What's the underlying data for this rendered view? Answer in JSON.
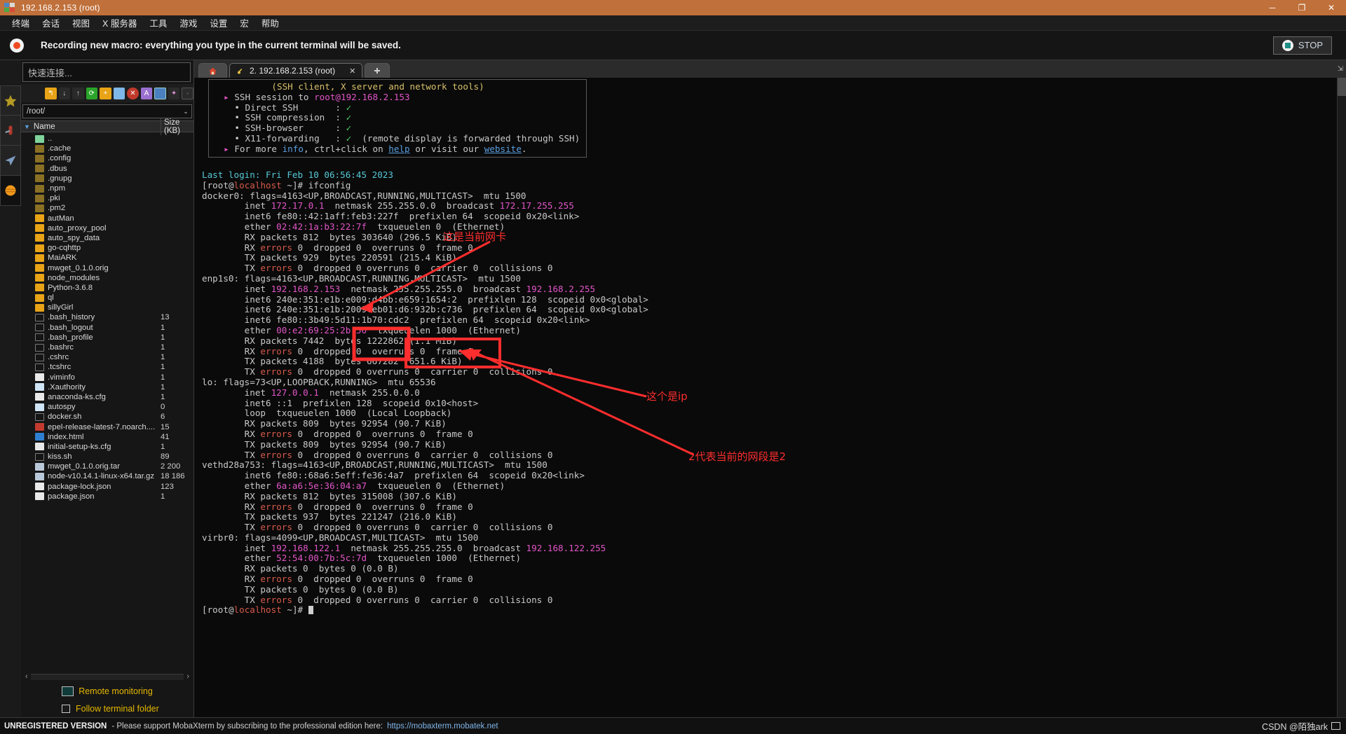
{
  "titlebar": {
    "title": "192.168.2.153 (root)",
    "minimize": "─",
    "maximize": "❐",
    "close": "✕"
  },
  "menubar": {
    "items": [
      "终端",
      "会话",
      "视图",
      "X 服务器",
      "工具",
      "游戏",
      "设置",
      "宏",
      "帮助"
    ]
  },
  "macrobar": {
    "message": "Recording new macro: everything you type in the current terminal will be saved.",
    "stop_label": "STOP"
  },
  "rail": {
    "items": [
      "star-icon",
      "tools-icon",
      "send-icon",
      "globe-icon"
    ]
  },
  "filebrowser": {
    "quick_connect_placeholder": "快速连接...",
    "path": "/root/",
    "columns": {
      "name": "Name",
      "size": "Size (KB)"
    },
    "sort_caret": "▼",
    "path_caret": "⌄",
    "toolbar_icons": [
      "up-dir-icon",
      "download-icon",
      "upload-icon",
      "refresh-icon",
      "new-folder-icon",
      "new-file-icon",
      "delete-icon",
      "text-view-icon",
      "split-view-icon",
      "magic-icon",
      "terminal-icon"
    ],
    "rows": [
      {
        "name": "..",
        "size": "",
        "icon": "up-folder-icon"
      },
      {
        "name": ".cache",
        "size": "",
        "icon": "folder-dim-icon"
      },
      {
        "name": ".config",
        "size": "",
        "icon": "folder-dim-icon"
      },
      {
        "name": ".dbus",
        "size": "",
        "icon": "folder-dim-icon"
      },
      {
        "name": ".gnupg",
        "size": "",
        "icon": "folder-dim-icon"
      },
      {
        "name": ".npm",
        "size": "",
        "icon": "folder-dim-icon"
      },
      {
        "name": ".pki",
        "size": "",
        "icon": "folder-dim-icon"
      },
      {
        "name": ".pm2",
        "size": "",
        "icon": "folder-dim-icon"
      },
      {
        "name": "autMan",
        "size": "",
        "icon": "folder-icon"
      },
      {
        "name": "auto_proxy_pool",
        "size": "",
        "icon": "folder-icon"
      },
      {
        "name": "auto_spy_data",
        "size": "",
        "icon": "folder-icon"
      },
      {
        "name": "go-cqhttp",
        "size": "",
        "icon": "folder-icon"
      },
      {
        "name": "MaiARK",
        "size": "",
        "icon": "folder-icon"
      },
      {
        "name": "mwget_0.1.0.orig",
        "size": "",
        "icon": "folder-icon"
      },
      {
        "name": "node_modules",
        "size": "",
        "icon": "folder-icon"
      },
      {
        "name": "Python-3.6.8",
        "size": "",
        "icon": "folder-icon"
      },
      {
        "name": "ql",
        "size": "",
        "icon": "folder-icon"
      },
      {
        "name": "sillyGirl",
        "size": "",
        "icon": "folder-icon"
      },
      {
        "name": ".bash_history",
        "size": "13",
        "icon": "shell-icon"
      },
      {
        "name": ".bash_logout",
        "size": "1",
        "icon": "shell-icon"
      },
      {
        "name": ".bash_profile",
        "size": "1",
        "icon": "shell-icon"
      },
      {
        "name": ".bashrc",
        "size": "1",
        "icon": "shell-icon"
      },
      {
        "name": ".cshrc",
        "size": "1",
        "icon": "shell-icon"
      },
      {
        "name": ".tcshrc",
        "size": "1",
        "icon": "shell-icon"
      },
      {
        "name": ".viminfo",
        "size": "1",
        "icon": "config-icon"
      },
      {
        "name": ".Xauthority",
        "size": "1",
        "icon": "file-icon"
      },
      {
        "name": "anaconda-ks.cfg",
        "size": "1",
        "icon": "config-icon"
      },
      {
        "name": "autospy",
        "size": "0",
        "icon": "file-icon"
      },
      {
        "name": "docker.sh",
        "size": "6",
        "icon": "shell-icon"
      },
      {
        "name": "epel-release-latest-7.noarch....",
        "size": "15",
        "icon": "rpm-icon"
      },
      {
        "name": "index.html",
        "size": "41",
        "icon": "html-icon"
      },
      {
        "name": "initial-setup-ks.cfg",
        "size": "1",
        "icon": "config-icon"
      },
      {
        "name": "kiss.sh",
        "size": "89",
        "icon": "shell-icon"
      },
      {
        "name": "mwget_0.1.0.orig.tar",
        "size": "2 200",
        "icon": "tar-icon"
      },
      {
        "name": "node-v10.14.1-linux-x64.tar.gz",
        "size": "18 186",
        "icon": "tar-icon"
      },
      {
        "name": "package-lock.json",
        "size": "123",
        "icon": "config-icon"
      },
      {
        "name": "package.json",
        "size": "1",
        "icon": "config-icon"
      }
    ],
    "scroll_left": "‹",
    "scroll_right": "›",
    "remote_monitoring": "Remote monitoring",
    "follow_terminal_folder": "Follow terminal folder"
  },
  "tabs": {
    "home_icon": "home-icon",
    "session": {
      "label": "2. 192.168.2.153 (root)",
      "close": "✕",
      "icon": "key-icon"
    },
    "new_tab": "➕",
    "corner": "⇲"
  },
  "terminal": {
    "banner": {
      "subtitle": "(SSH client, X server and network tools)",
      "session_line_prefix": "SSH session to ",
      "session_host": "root@192.168.2.153",
      "checks": [
        {
          "label": "Direct SSH",
          "pad": "      ",
          "mark": "✓",
          "note": ""
        },
        {
          "label": "SSH compression",
          "pad": "",
          "mark": "✓",
          "note": ""
        },
        {
          "label": "SSH-browser",
          "pad": "    ",
          "mark": "✓",
          "note": ""
        },
        {
          "label": "X11-forwarding",
          "pad": " ",
          "mark": "✓",
          "note": "(remote display is forwarded through SSH)"
        }
      ],
      "more_pre": "For more ",
      "more_info": "info",
      "more_mid": ", ctrl+click on ",
      "more_help": "help",
      "more_mid2": " or visit our ",
      "more_site": "website",
      "more_end": "."
    },
    "last_login": "Last login: Fri Feb 10 06:56:45 2023",
    "prompt_user": "root",
    "prompt_at": "@",
    "prompt_host": "localhost",
    "prompt_tail": " ~]# ",
    "command": "ifconfig",
    "interfaces": [
      {
        "name": "docker0",
        "flags": ": flags=4163<UP,BROADCAST,RUNNING,MULTICAST>  mtu 1500",
        "lines": [
          {
            "parts": [
              {
                "t": "        inet ",
                "c": "grey"
              },
              {
                "t": "172.17.0.1",
                "c": "pink"
              },
              {
                "t": "  netmask 255.255.0.0  broadcast ",
                "c": "grey"
              },
              {
                "t": "172.17.255.255",
                "c": "pink"
              }
            ]
          },
          {
            "parts": [
              {
                "t": "        inet6 fe80::42:1aff:feb3:227f  prefixlen 64  scopeid 0x20<link>",
                "c": "grey"
              }
            ]
          },
          {
            "parts": [
              {
                "t": "        ether ",
                "c": "grey"
              },
              {
                "t": "02:42:1a:b3:22:7f",
                "c": "pink"
              },
              {
                "t": "  txqueuelen 0  (Ethernet)",
                "c": "grey"
              }
            ]
          },
          {
            "parts": [
              {
                "t": "        RX packets 812  bytes 303640 (296.5 KiB)",
                "c": "grey"
              }
            ]
          },
          {
            "parts": [
              {
                "t": "        RX ",
                "c": "grey"
              },
              {
                "t": "errors",
                "c": "red"
              },
              {
                "t": " 0  dropped 0  overruns 0  frame 0",
                "c": "grey"
              }
            ]
          },
          {
            "parts": [
              {
                "t": "        TX packets 929  bytes 220591 (215.4 KiB)",
                "c": "grey"
              }
            ]
          },
          {
            "parts": [
              {
                "t": "        TX ",
                "c": "grey"
              },
              {
                "t": "errors",
                "c": "red"
              },
              {
                "t": " 0  dropped 0 overruns 0  carrier 0  collisions 0",
                "c": "grey"
              }
            ]
          }
        ]
      },
      {
        "name": "enp1s0",
        "flags": ": flags=4163<UP,BROADCAST,RUNNING,MULTICAST>  mtu 1500",
        "lines": [
          {
            "parts": [
              {
                "t": "        inet ",
                "c": "grey"
              },
              {
                "t": "192.168.2.153",
                "c": "pink"
              },
              {
                "t": "  netmask 255.255.255.0  broadcast ",
                "c": "grey"
              },
              {
                "t": "192.168.2.255",
                "c": "pink"
              }
            ]
          },
          {
            "parts": [
              {
                "t": "        inet6 240e:351:e1b:e009:d4bb:e659:1654:2  prefixlen 128  scopeid 0x0<global>",
                "c": "grey"
              }
            ]
          },
          {
            "parts": [
              {
                "t": "        inet6 240e:351:e1b:2009:eb01:d6:932b:c736  prefixlen 64  scopeid 0x0<global>",
                "c": "grey"
              }
            ]
          },
          {
            "parts": [
              {
                "t": "        inet6 fe80::3b49:5d11:1b70:cdc2  prefixlen 64  scopeid 0x20<link>",
                "c": "grey"
              }
            ]
          },
          {
            "parts": [
              {
                "t": "        ether ",
                "c": "grey"
              },
              {
                "t": "00:e2:69:25:2b:56",
                "c": "pink"
              },
              {
                "t": "  txqueuelen 1000  (Ethernet)",
                "c": "grey"
              }
            ]
          },
          {
            "parts": [
              {
                "t": "        RX packets 7442  bytes 1222862 (1.1 MiB)",
                "c": "grey"
              }
            ]
          },
          {
            "parts": [
              {
                "t": "        RX ",
                "c": "grey"
              },
              {
                "t": "errors",
                "c": "red"
              },
              {
                "t": " 0  dropped 0  overruns 0  frame 0",
                "c": "grey"
              }
            ]
          },
          {
            "parts": [
              {
                "t": "        TX packets 4188  bytes 667282 (651.6 KiB)",
                "c": "grey"
              }
            ]
          },
          {
            "parts": [
              {
                "t": "        TX ",
                "c": "grey"
              },
              {
                "t": "errors",
                "c": "red"
              },
              {
                "t": " 0  dropped 0 overruns 0  carrier 0  collisions 0",
                "c": "grey"
              }
            ]
          }
        ]
      },
      {
        "name": "lo",
        "flags": ": flags=73<UP,LOOPBACK,RUNNING>  mtu 65536",
        "lines": [
          {
            "parts": [
              {
                "t": "        inet ",
                "c": "grey"
              },
              {
                "t": "127.0.0.1",
                "c": "pink"
              },
              {
                "t": "  netmask 255.0.0.0",
                "c": "grey"
              }
            ]
          },
          {
            "parts": [
              {
                "t": "        inet6 ::1  prefixlen 128  scopeid 0x10<host>",
                "c": "grey"
              }
            ]
          },
          {
            "parts": [
              {
                "t": "        loop  txqueuelen 1000  (Local Loopback)",
                "c": "grey"
              }
            ]
          },
          {
            "parts": [
              {
                "t": "        RX packets 809  bytes 92954 (90.7 KiB)",
                "c": "grey"
              }
            ]
          },
          {
            "parts": [
              {
                "t": "        RX ",
                "c": "grey"
              },
              {
                "t": "errors",
                "c": "red"
              },
              {
                "t": " 0  dropped 0  overruns 0  frame 0",
                "c": "grey"
              }
            ]
          },
          {
            "parts": [
              {
                "t": "        TX packets 809  bytes 92954 (90.7 KiB)",
                "c": "grey"
              }
            ]
          },
          {
            "parts": [
              {
                "t": "        TX ",
                "c": "grey"
              },
              {
                "t": "errors",
                "c": "red"
              },
              {
                "t": " 0  dropped 0 overruns 0  carrier 0  collisions 0",
                "c": "grey"
              }
            ]
          }
        ]
      },
      {
        "name": "vethd28a753",
        "flags": ": flags=4163<UP,BROADCAST,RUNNING,MULTICAST>  mtu 1500",
        "lines": [
          {
            "parts": [
              {
                "t": "        inet6 fe80::68a6:5eff:fe36:4a7  prefixlen 64  scopeid 0x20<link>",
                "c": "grey"
              }
            ]
          },
          {
            "parts": [
              {
                "t": "        ether ",
                "c": "grey"
              },
              {
                "t": "6a:a6:5e:36:04:a7",
                "c": "pink"
              },
              {
                "t": "  txqueuelen 0  (Ethernet)",
                "c": "grey"
              }
            ]
          },
          {
            "parts": [
              {
                "t": "        RX packets 812  bytes 315008 (307.6 KiB)",
                "c": "grey"
              }
            ]
          },
          {
            "parts": [
              {
                "t": "        RX ",
                "c": "grey"
              },
              {
                "t": "errors",
                "c": "red"
              },
              {
                "t": " 0  dropped 0  overruns 0  frame 0",
                "c": "grey"
              }
            ]
          },
          {
            "parts": [
              {
                "t": "        TX packets 937  bytes 221247 (216.0 KiB)",
                "c": "grey"
              }
            ]
          },
          {
            "parts": [
              {
                "t": "        TX ",
                "c": "grey"
              },
              {
                "t": "errors",
                "c": "red"
              },
              {
                "t": " 0  dropped 0 overruns 0  carrier 0  collisions 0",
                "c": "grey"
              }
            ]
          }
        ]
      },
      {
        "name": "virbr0",
        "flags": ": flags=4099<UP,BROADCAST,MULTICAST>  mtu 1500",
        "lines": [
          {
            "parts": [
              {
                "t": "        inet ",
                "c": "grey"
              },
              {
                "t": "192.168.122.1",
                "c": "pink"
              },
              {
                "t": "  netmask 255.255.255.0  broadcast ",
                "c": "grey"
              },
              {
                "t": "192.168.122.255",
                "c": "pink"
              }
            ]
          },
          {
            "parts": [
              {
                "t": "        ether ",
                "c": "grey"
              },
              {
                "t": "52:54:00:7b:5c:7d",
                "c": "pink"
              },
              {
                "t": "  txqueuelen 1000  (Ethernet)",
                "c": "grey"
              }
            ]
          },
          {
            "parts": [
              {
                "t": "        RX packets 0  bytes 0 (0.0 B)",
                "c": "grey"
              }
            ]
          },
          {
            "parts": [
              {
                "t": "        RX ",
                "c": "grey"
              },
              {
                "t": "errors",
                "c": "red"
              },
              {
                "t": " 0  dropped 0  overruns 0  frame 0",
                "c": "grey"
              }
            ]
          },
          {
            "parts": [
              {
                "t": "        TX packets 0  bytes 0 (0.0 B)",
                "c": "grey"
              }
            ]
          },
          {
            "parts": [
              {
                "t": "        TX ",
                "c": "grey"
              },
              {
                "t": "errors",
                "c": "red"
              },
              {
                "t": " 0  dropped 0 overruns 0  carrier 0  collisions 0",
                "c": "grey"
              }
            ]
          }
        ]
      }
    ]
  },
  "annotations": {
    "nic_label": "这是当前网卡",
    "ip_label": "这个是ip",
    "segment_label": "2代表当前的网段是2",
    "color": "#ff2d2d"
  },
  "statusbar": {
    "unregistered": "UNREGISTERED VERSION",
    "message": "- Please support MobaXterm by subscribing to the professional edition here:",
    "link": "https://mobaxterm.mobatek.net",
    "watermark": "CSDN @陌独ark"
  }
}
